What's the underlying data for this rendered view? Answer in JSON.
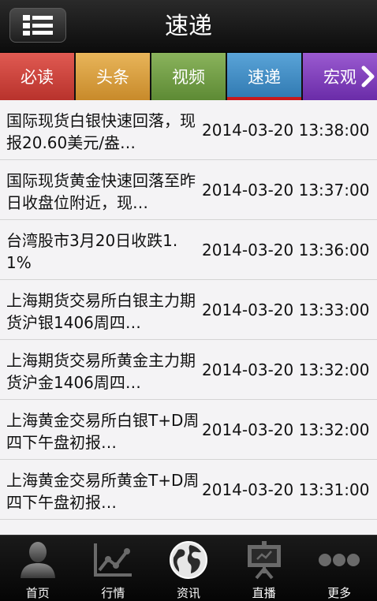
{
  "header": {
    "title": "速递",
    "menu_icon": "list-menu-icon"
  },
  "tabs": [
    {
      "label": "必读",
      "color": "#c8433c"
    },
    {
      "label": "头条",
      "color": "#d89e42"
    },
    {
      "label": "视频",
      "color": "#739f48"
    },
    {
      "label": "速递",
      "color": "#448ec4",
      "selected": true,
      "indicator_color": "#c8191c"
    },
    {
      "label": "宏观",
      "color": "#8243bc"
    }
  ],
  "news": [
    {
      "title": "国际现货白银快速回落，现报20.60美元/盎…",
      "time": "2014-03-20 13:38:00"
    },
    {
      "title": "国际现货黄金快速回落至昨日收盘位附近，现…",
      "time": "2014-03-20 13:37:00"
    },
    {
      "title": "台湾股市3月20日收跌1.1%",
      "time": "2014-03-20 13:36:00"
    },
    {
      "title": "上海期货交易所白银主力期货沪银1406周四…",
      "time": "2014-03-20 13:33:00"
    },
    {
      "title": "上海期货交易所黄金主力期货沪金1406周四…",
      "time": "2014-03-20 13:32:00"
    },
    {
      "title": "上海黄金交易所白银T+D周四下午盘初报…",
      "time": "2014-03-20 13:32:00"
    },
    {
      "title": "上海黄金交易所黄金T+D周四下午盘初报…",
      "time": "2014-03-20 13:31:00"
    }
  ],
  "bottom_nav": [
    {
      "label": "首页",
      "icon": "person-icon"
    },
    {
      "label": "行情",
      "icon": "line-chart-icon"
    },
    {
      "label": "资讯",
      "icon": "globe-icon",
      "active": true
    },
    {
      "label": "直播",
      "icon": "presentation-icon"
    },
    {
      "label": "更多",
      "icon": "more-dots-icon"
    }
  ]
}
